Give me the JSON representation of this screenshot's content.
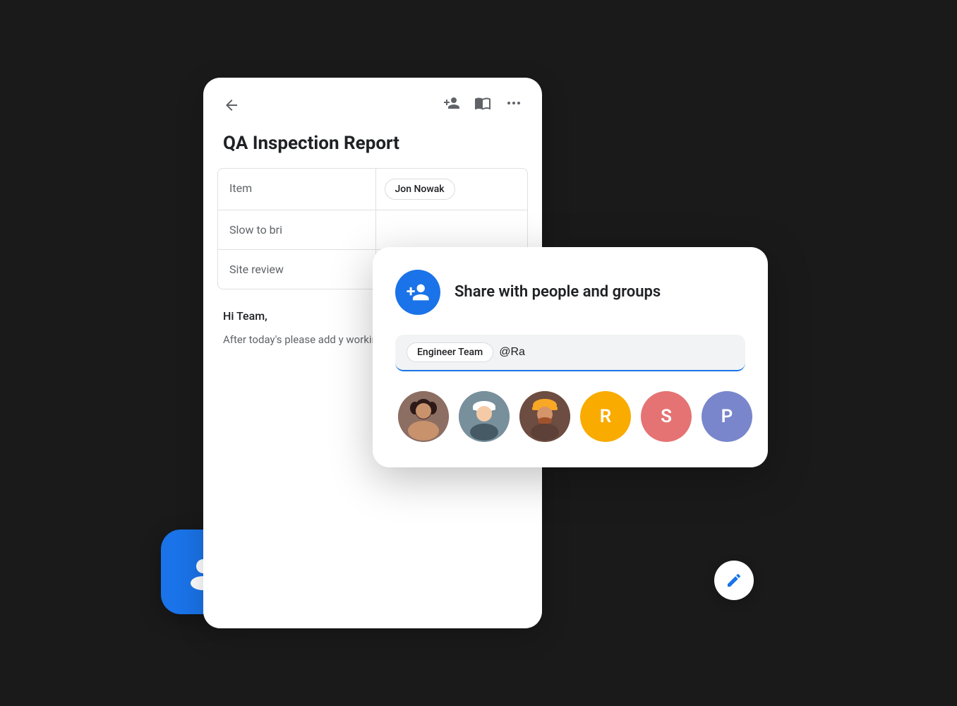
{
  "scene": {
    "main_card": {
      "back_button": "←",
      "title": "QA Inspection Report",
      "header_icons": [
        "person-add",
        "description",
        "more-horiz"
      ],
      "table": {
        "rows": [
          {
            "left": "Item",
            "right_chip": "Jon Nowak"
          },
          {
            "left": "Slow to bri",
            "right_chip": ""
          },
          {
            "left": "Site review",
            "right_chip": ""
          }
        ]
      },
      "body": {
        "greeting": "Hi Team,",
        "paragraph": "After today's please add y working doc before next week."
      }
    },
    "share_dialog": {
      "title": "Share with people and groups",
      "input": {
        "tag": "Engineer Team",
        "value": "@Ra"
      },
      "avatars": [
        {
          "type": "photo",
          "id": "avatar1",
          "label": "Person 1"
        },
        {
          "type": "photo",
          "id": "avatar2",
          "label": "Person 2"
        },
        {
          "type": "photo",
          "id": "avatar3",
          "label": "Person 3"
        },
        {
          "type": "letter",
          "letter": "R",
          "color_class": "r-color"
        },
        {
          "type": "letter",
          "letter": "S",
          "color_class": "s-color"
        },
        {
          "type": "letter",
          "letter": "P",
          "color_class": "p-color"
        }
      ]
    },
    "edit_fab": {
      "icon": "✏"
    },
    "blue_card": {
      "icon": "person"
    }
  }
}
